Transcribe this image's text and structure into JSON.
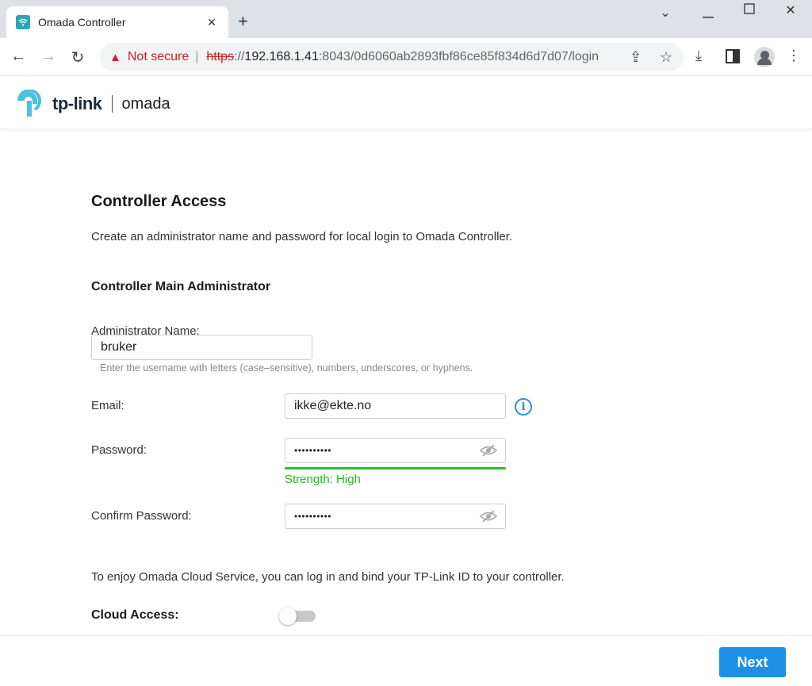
{
  "browser": {
    "tab_title": "Omada Controller",
    "tab_close_icon": "close-icon",
    "new_tab_icon": "plus-icon",
    "url_warning": "Not secure",
    "url_scheme": "https",
    "url_sep": "://",
    "url_host": "192.168.1.41",
    "url_path": ":8043/0d6060ab2893fbf86ce85f834d6d7d07/login"
  },
  "header": {
    "brand": "tp-link",
    "product": "omada"
  },
  "form": {
    "title": "Controller Access",
    "description": "Create an administrator name and password for local login to Omada Controller.",
    "section_title": "Controller Main Administrator",
    "admin_name_label": "Administrator Name:",
    "admin_name_value": "bruker",
    "admin_name_hint": "Enter the username with letters (case–sensitive), numbers, underscores, or hyphens.",
    "email_label": "Email:",
    "email_value": "ikke@ekte.no",
    "password_label": "Password:",
    "password_value": "••••••••••",
    "strength_text": "Strength: High",
    "confirm_label": "Confirm Password:",
    "confirm_value": "••••••••••",
    "cloud_description": "To enjoy Omada Cloud Service, you can log in and bind your TP-Link ID to your controller.",
    "cloud_label": "Cloud Access:",
    "cloud_enabled": false
  },
  "footer": {
    "next_label": "Next"
  },
  "colors": {
    "accent": "#1e8fe6",
    "strength": "#22c322",
    "warning": "#c5221f"
  }
}
